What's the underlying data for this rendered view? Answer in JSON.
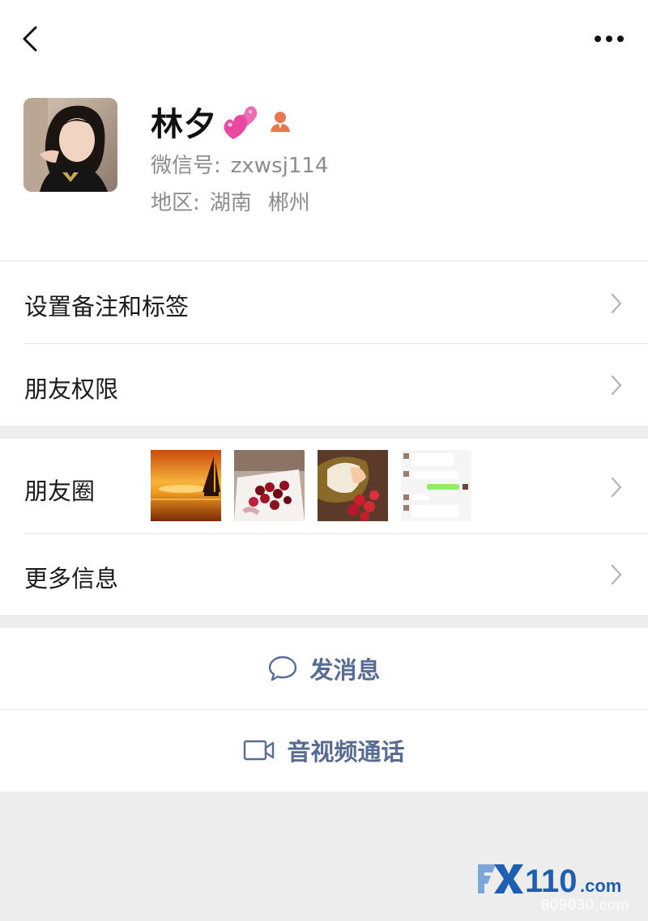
{
  "profile": {
    "name": "林夕",
    "wechat_id_label": "微信号:",
    "wechat_id": "zxwsj114",
    "region_label": "地区:",
    "region_province": "湖南",
    "region_city": "郴州"
  },
  "menu": {
    "set_remark": "设置备注和标签",
    "friend_permissions": "朋友权限",
    "moments": "朋友圈",
    "more_info": "更多信息"
  },
  "actions": {
    "send_message": "发消息",
    "video_call": "音视频通话"
  },
  "icons": {
    "back": "chevron-left-icon",
    "more": "ellipsis-icon",
    "chevron": "chevron-right-icon",
    "message": "chat-bubble-icon",
    "video": "video-camera-icon",
    "hearts": "two-hearts-emoji",
    "badge": "person-badge-icon"
  },
  "watermark": {
    "logo_text": "FX110.com",
    "site_text": "809030.com"
  },
  "colors": {
    "link_blue": "#576b95",
    "secondary_text": "#8c8c8c",
    "background": "#ededed"
  }
}
